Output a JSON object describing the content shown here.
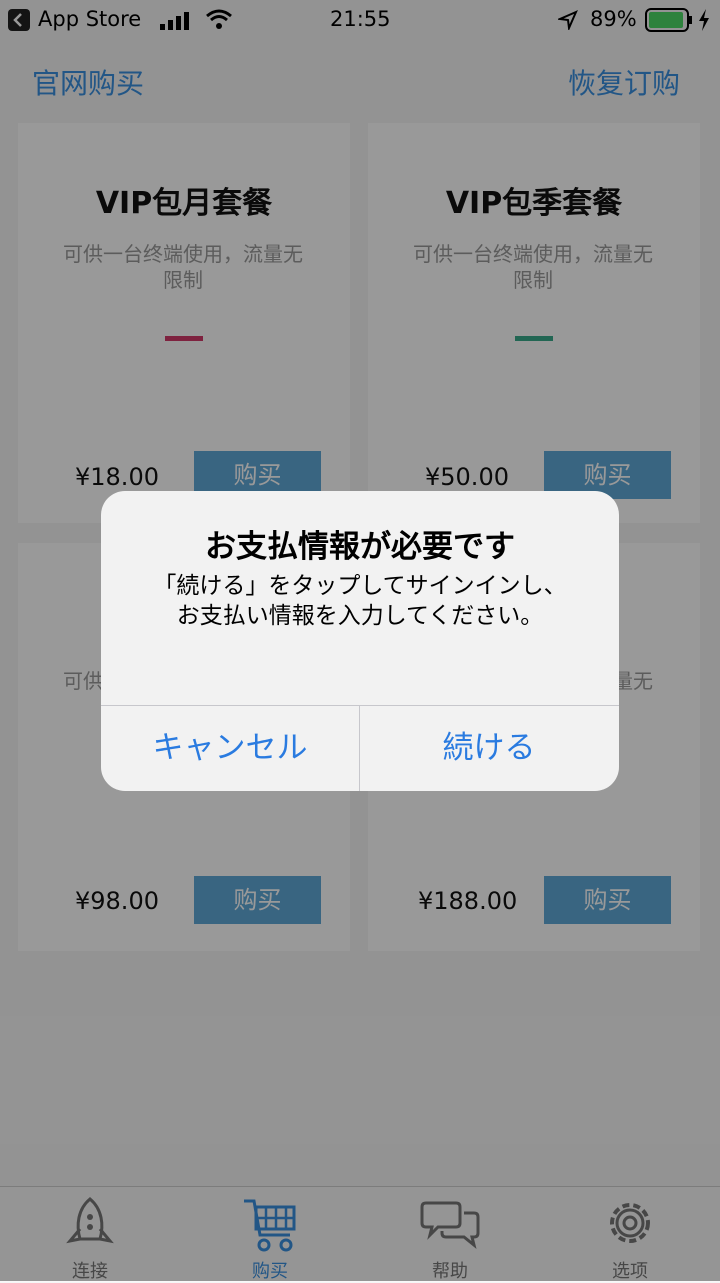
{
  "status_bar": {
    "back_app": "App Store",
    "time": "21:55",
    "battery": "89%"
  },
  "top_nav": {
    "left": "官网购买",
    "right": "恢复订购"
  },
  "plans": [
    {
      "title": "VIP包月套餐",
      "desc": "可供一台终端使用，流量无限制",
      "price": "¥18.00",
      "buy": "购买",
      "accent": "#d23a6a"
    },
    {
      "title": "VIP包季套餐",
      "desc": "可供一台终端使用，流量无限制",
      "price": "¥50.00",
      "buy": "购买",
      "accent": "#3aaa8a"
    },
    {
      "title": "",
      "desc": "可供一台终端使用，流量无限制",
      "price": "¥98.00",
      "buy": "购买"
    },
    {
      "title": "",
      "desc": "可供一台终端使用，流量无限制",
      "price": "¥188.00",
      "buy": "购买"
    }
  ],
  "alert": {
    "title": "お支払情報が必要です",
    "message": "「続ける」をタップしてサインインし、お支払い情報を入力してください。",
    "cancel": "キャンセル",
    "continue": "続ける"
  },
  "tabs": [
    {
      "label": "连接",
      "icon": "rocket-icon"
    },
    {
      "label": "购买",
      "icon": "cart-icon",
      "active": true
    },
    {
      "label": "帮助",
      "icon": "chat-bubbles-icon"
    },
    {
      "label": "选项",
      "icon": "gear-icon"
    }
  ],
  "colors": {
    "accent_blue": "#3a8fe0",
    "buy_button": "#5fa8d8",
    "alert_button": "#2a7be0",
    "battery_green": "#4cd964"
  }
}
